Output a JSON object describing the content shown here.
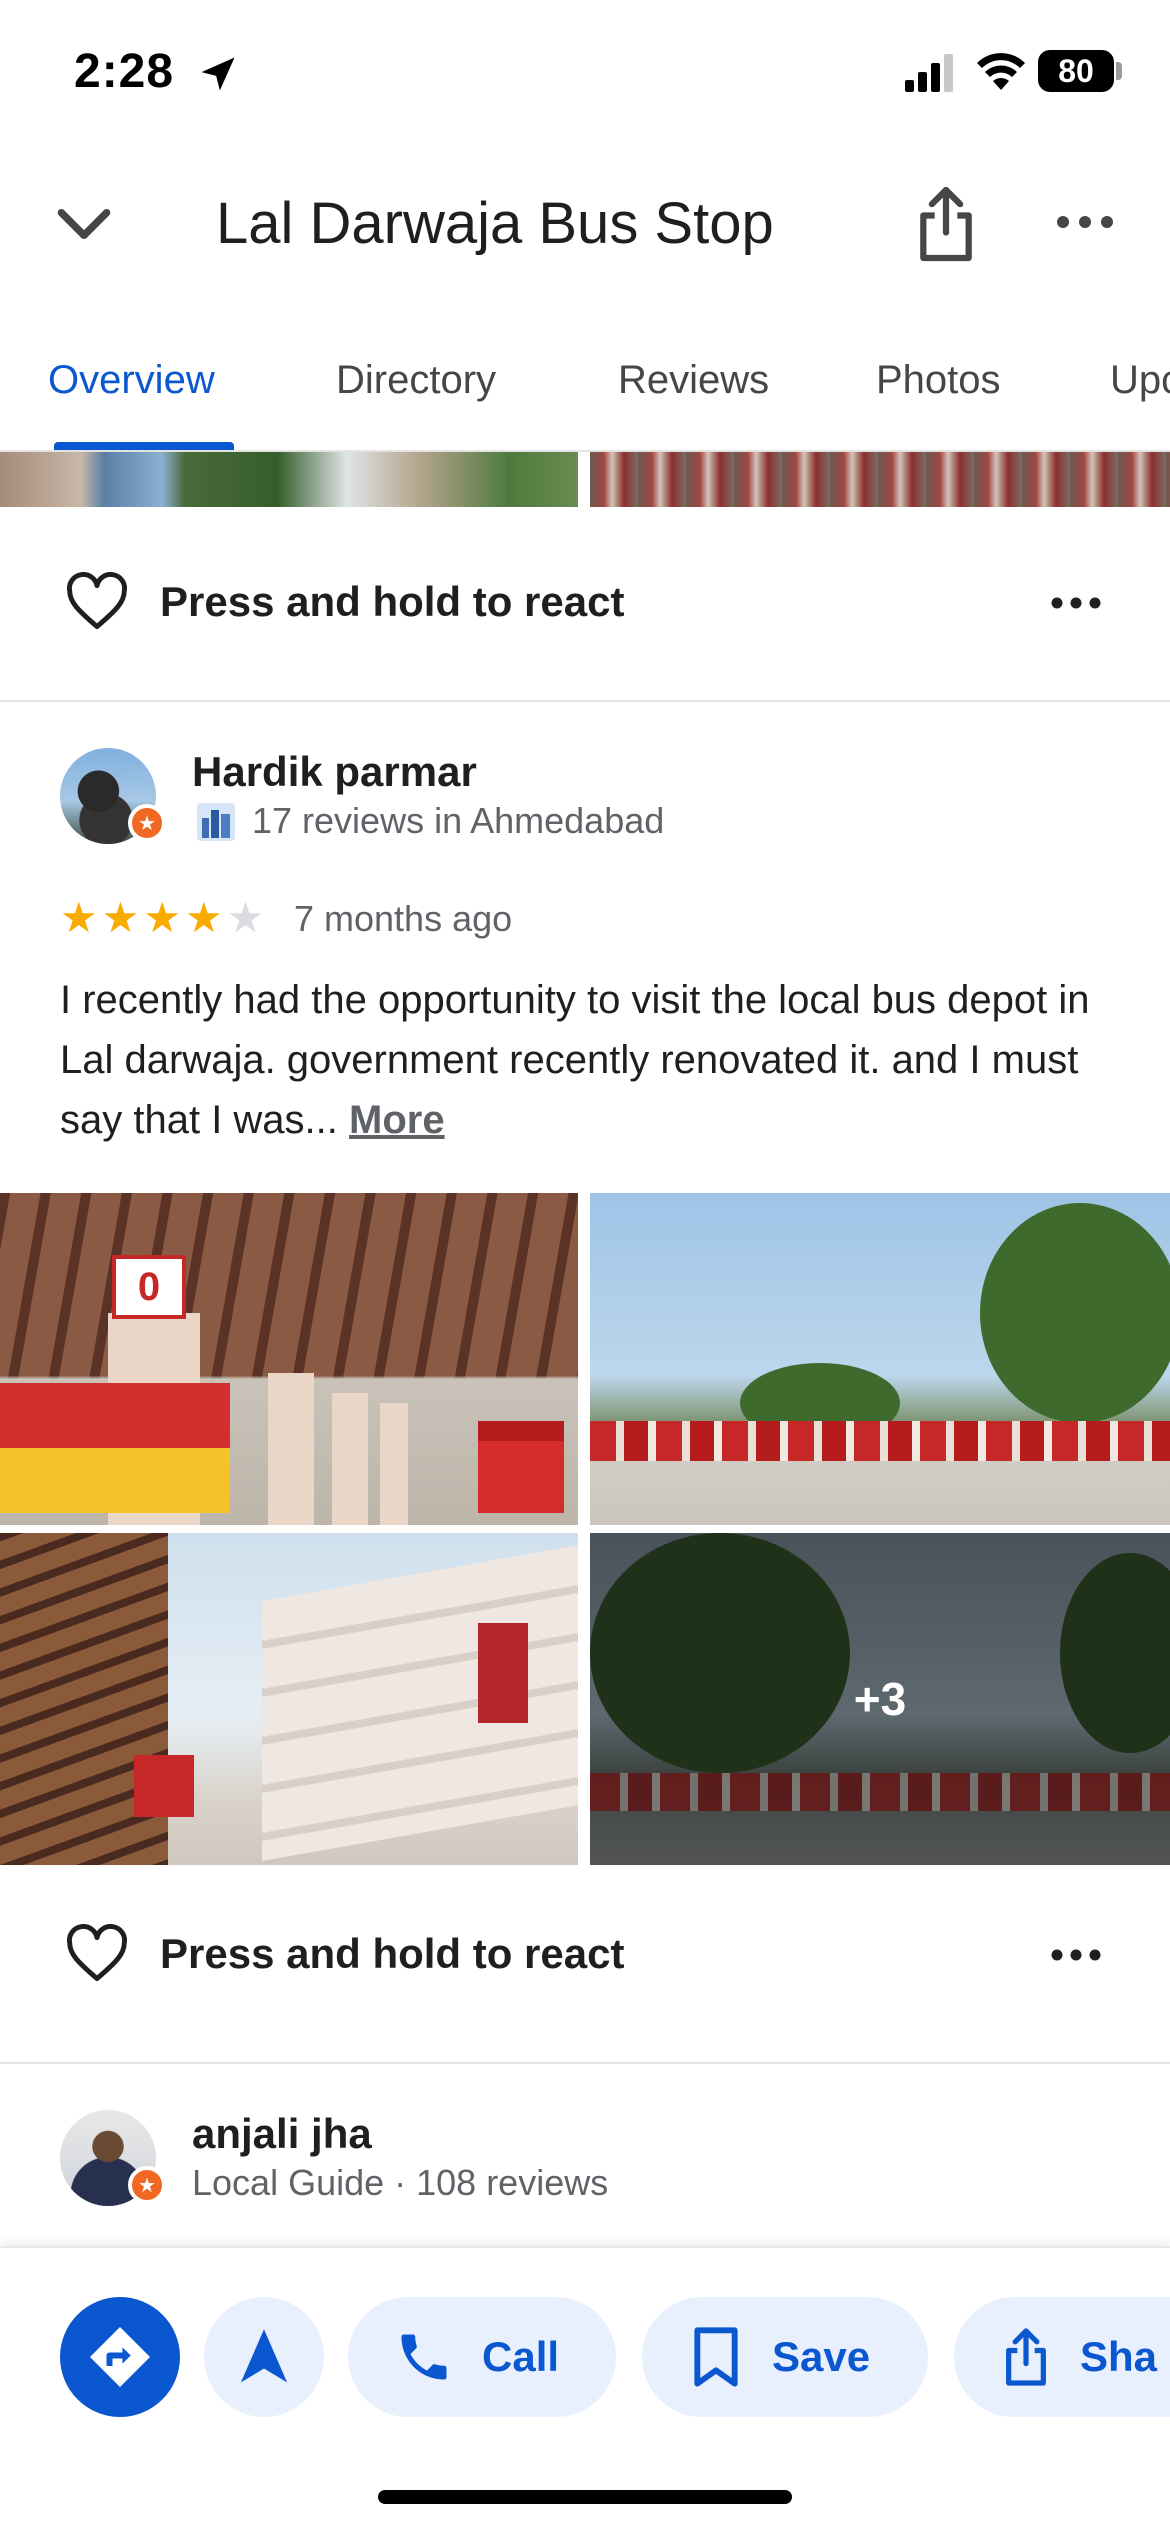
{
  "status_bar": {
    "time": "2:28",
    "battery": "80"
  },
  "header": {
    "title": "Lal Darwaja Bus Stop"
  },
  "tabs": [
    {
      "label": "Overview",
      "active": true
    },
    {
      "label": "Directory"
    },
    {
      "label": "Reviews"
    },
    {
      "label": "Photos"
    },
    {
      "label": "Upc"
    }
  ],
  "react": {
    "label": "Press and hold to react"
  },
  "review_1": {
    "name": "Hardik parmar",
    "meta": "17 reviews in Ahmedabad",
    "rating": 4,
    "time_ago": "7 months ago",
    "text": "I recently had the opportunity to visit the local bus depot in Lal darwaja. government recently renovated it. and I must say that I was... ",
    "more_label": "More",
    "photo_sign": "0",
    "more_photos": "+3"
  },
  "review_2": {
    "name": "anjali jha",
    "meta": "Local Guide · 108 reviews"
  },
  "actions": {
    "call_label": "Call",
    "save_label": "Save",
    "share_label": "Sha"
  },
  "colors": {
    "accent": "#0b57d0",
    "pill_bg": "#e8f0fe",
    "star": "#f9ab00",
    "guide_badge": "#f26722"
  }
}
